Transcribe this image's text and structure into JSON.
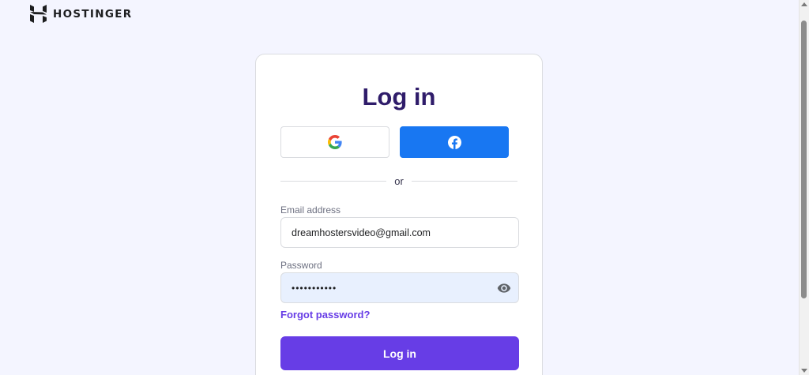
{
  "brand": {
    "name": "HOSTINGER",
    "logo_icon": "hostinger-h-logo"
  },
  "card": {
    "title": "Log in",
    "social": {
      "google_icon": "google-g-icon",
      "facebook_icon": "facebook-f-icon",
      "facebook_color": "#1877f2"
    },
    "divider_text": "or",
    "email": {
      "label": "Email address",
      "value": "dreamhostersvideo@gmail.com"
    },
    "password": {
      "label": "Password",
      "masked_value": "•••••••••••",
      "toggle_icon": "eye-icon"
    },
    "forgot_password": "Forgot password?",
    "submit_label": "Log in"
  },
  "colors": {
    "accent": "#673de6",
    "title": "#2f1c6a",
    "background": "#f4f5ff",
    "autofill": "#e8f0fe"
  }
}
